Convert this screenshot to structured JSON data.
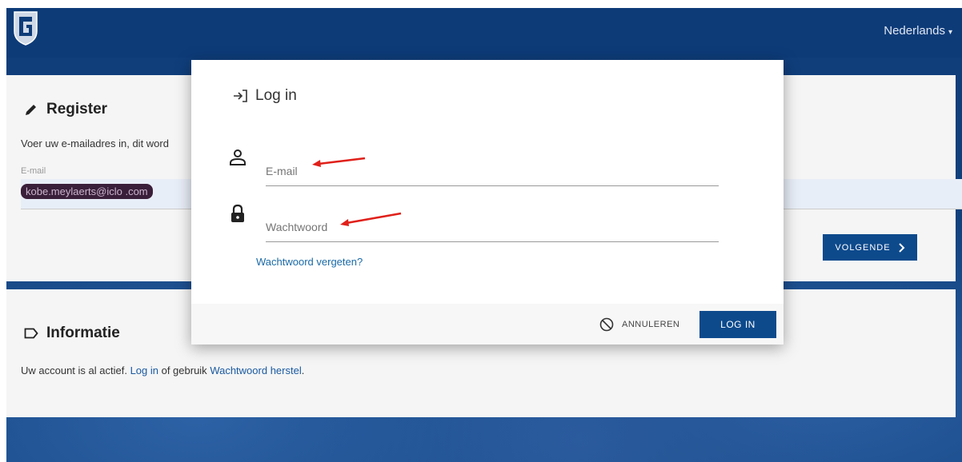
{
  "header": {
    "language": "Nederlands",
    "language_caret": "▾"
  },
  "register": {
    "title": "Register",
    "description": "Voer uw e-mailadres in, dit word",
    "email_label": "E-mail",
    "email_value": "kobe.meylaerts@iclo .com",
    "next_label": "VOLGENDE"
  },
  "info": {
    "title": "Informatie",
    "text_before": "Uw account is al actief. ",
    "login_link": "Log in",
    "text_middle": " of gebruik ",
    "reset_link": "Wachtwoord herstel",
    "text_after": "."
  },
  "login_modal": {
    "title": "Log in",
    "email_placeholder": "E-mail",
    "password_placeholder": "Wachtwoord",
    "forgot_link": "Wachtwoord vergeten?",
    "cancel_label": "ANNULEREN",
    "login_label": "LOG IN"
  },
  "colors": {
    "brand_blue": "#0d4a8c",
    "link_blue": "#1a6aa8",
    "annotation_red": "#e0201a"
  }
}
